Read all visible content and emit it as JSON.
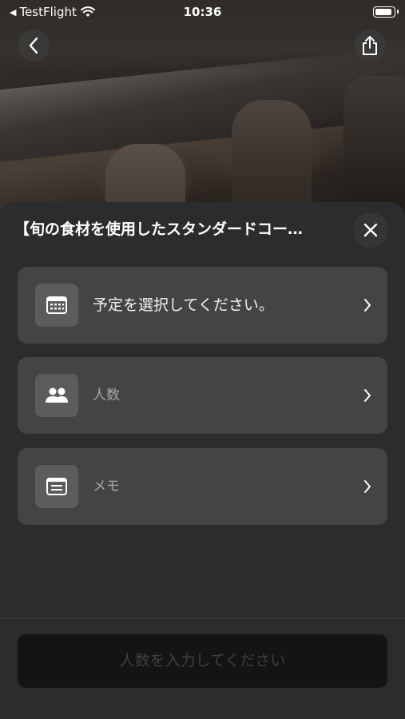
{
  "status_bar": {
    "back_app": "TestFlight",
    "time": "10:36"
  },
  "sheet": {
    "title": "【旬の食材を使用したスタンダードコー…",
    "rows": [
      {
        "label": "予定を選択してください。",
        "icon": "calendar-icon"
      },
      {
        "label": "人数",
        "icon": "people-icon"
      },
      {
        "label": "メモ",
        "icon": "memo-icon"
      }
    ],
    "submit_label": "人数を入力してください"
  },
  "colors": {
    "sheet_bg": "#2c2c2e",
    "row_bg": "#444446",
    "icon_box_bg": "#5c5c5e",
    "submit_bg": "#141414"
  }
}
